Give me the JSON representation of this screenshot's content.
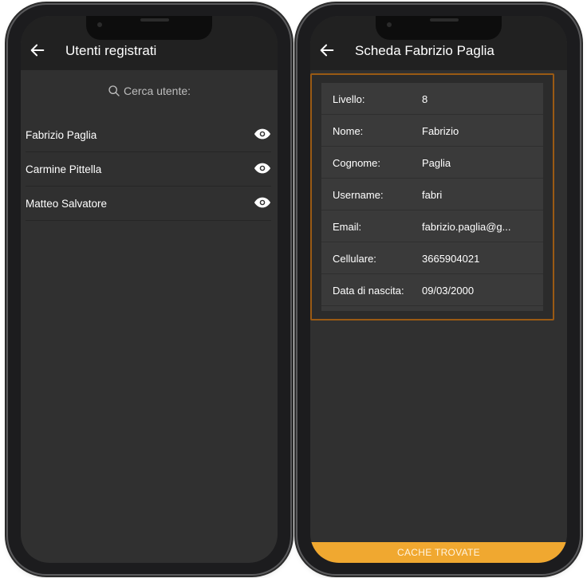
{
  "left_screen": {
    "title": "Utenti registrati",
    "search_placeholder": "Cerca utente:",
    "users": [
      {
        "name": "Fabrizio Paglia"
      },
      {
        "name": "Carmine Pittella"
      },
      {
        "name": "Matteo Salvatore"
      }
    ]
  },
  "right_screen": {
    "title": "Scheda Fabrizio Paglia",
    "fields": [
      {
        "label": "Livello:",
        "value": "8"
      },
      {
        "label": "Nome:",
        "value": "Fabrizio"
      },
      {
        "label": "Cognome:",
        "value": "Paglia"
      },
      {
        "label": "Username:",
        "value": "fabri"
      },
      {
        "label": "Email:",
        "value": "fabrizio.paglia@g..."
      },
      {
        "label": "Cellulare:",
        "value": "3665904021"
      },
      {
        "label": "Data di nascita:",
        "value": "09/03/2000"
      }
    ],
    "bottom_button": "CACHE TROVATE"
  },
  "colors": {
    "appbar": "#212121",
    "background": "#303030",
    "card_border": "#9a5a14",
    "accent": "#f0a830"
  },
  "icons": [
    "back-arrow-icon",
    "search-icon",
    "eye-icon"
  ]
}
